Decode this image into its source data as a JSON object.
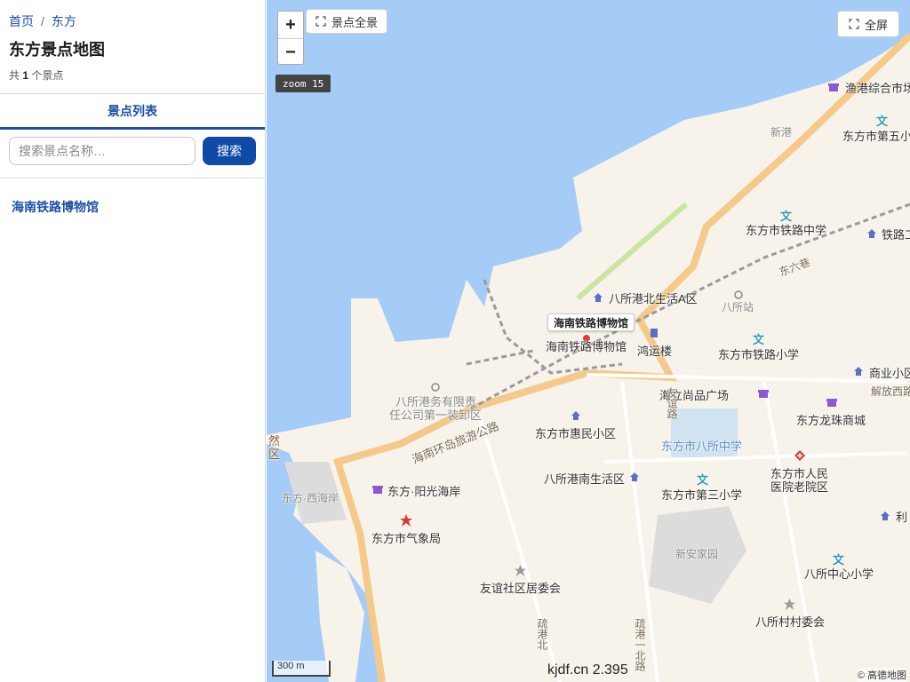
{
  "sidebar": {
    "breadcrumb": {
      "home": "首页",
      "separator": "/",
      "current": "东方"
    },
    "title": "东方景点地图",
    "count_prefix": "共",
    "count_value": "1",
    "count_suffix": "个景点",
    "tab_label": "景点列表",
    "search": {
      "placeholder": "搜索景点名称…",
      "value": "",
      "button_label": "搜索"
    },
    "results": [
      {
        "name": "海南铁路博物馆"
      }
    ]
  },
  "map": {
    "zoom_in": "+",
    "zoom_out": "−",
    "extent_label": "景点全景",
    "fullscreen_label": "全屏",
    "zoom_badge": "zoom 15",
    "scale_label": "300 m",
    "watermark": "kjdf.cn 2.395",
    "copyright": "© 高德地图",
    "popup_label": "海南铁路博物馆",
    "colors": {
      "water": "#a5ccf6",
      "land": "#f7f3ea",
      "road": "#f5c98a",
      "accent": "#0f4aa8",
      "marker": "#e53935"
    },
    "labels": {
      "yugang": "渔港综合市场",
      "diwu": "东方市第五小",
      "xingang": "新港",
      "tielu_zhong": "东方市铁路中学",
      "tielu_gong": "铁路工",
      "dongliuxiang": "东六巷",
      "bsgbei": "八所港北生活A区",
      "basuozhan": "八所站",
      "museum": "海南铁路博物馆",
      "hongyun": "鸿运楼",
      "tielu_xiao": "东方市铁路小学",
      "shangye": "商业小区",
      "jiefang": "解放西路",
      "gangwu_1": "八所港务有限责",
      "gangwu_2": "任公司第一装卸区",
      "haili": "海立尚品广场",
      "youyi_lu": "友谊路",
      "longzhu": "东方龙珠商城",
      "huanlu": "海南环岛旅游公路",
      "huimin": "东方市惠民小区",
      "bazhong": "东方市八所中学",
      "renmin_1": "东方市人民",
      "renmin_2": "医院老院区",
      "ziran_1": "然",
      "ziran_2": "区",
      "xihaian": "东方·西海岸",
      "yangguang": "东方·阳光海岸",
      "nansheng": "八所港南生活区",
      "disan": "东方市第三小学",
      "qixiang": "东方市气象局",
      "xinan": "新安家园",
      "li": "利",
      "zhongxin": "八所中心小学",
      "youyi_ju": "友谊社区居委会",
      "cun": "八所村村委会",
      "shugangbei": "疏港北",
      "shugang1": "疏港一北路"
    }
  }
}
